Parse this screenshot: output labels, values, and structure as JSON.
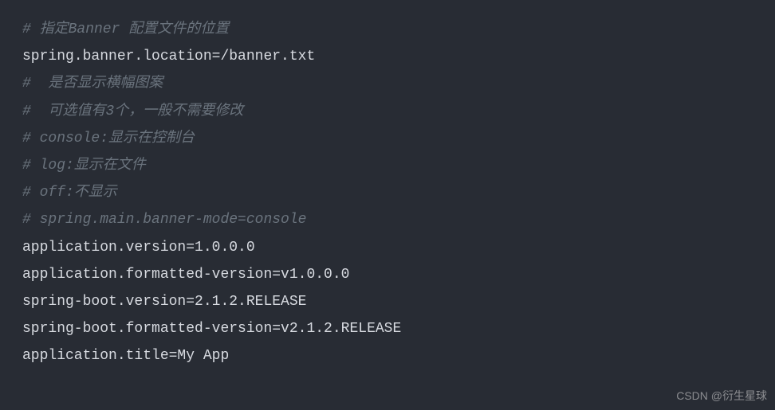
{
  "code": {
    "lines": [
      {
        "text": "# 指定Banner 配置文件的位置",
        "type": "comment"
      },
      {
        "text": "spring.banner.location=/banner.txt",
        "type": "property"
      },
      {
        "text": "#  是否显示横幅图案",
        "type": "comment"
      },
      {
        "text": "#  可选值有3个，一般不需要修改",
        "type": "comment"
      },
      {
        "text": "# console:显示在控制台",
        "type": "comment"
      },
      {
        "text": "# log:显示在文件",
        "type": "comment"
      },
      {
        "text": "# off:不显示",
        "type": "comment"
      },
      {
        "text": "# spring.main.banner-mode=console",
        "type": "comment"
      },
      {
        "text": "application.version=1.0.0.0",
        "type": "property"
      },
      {
        "text": "application.formatted-version=v1.0.0.0",
        "type": "property"
      },
      {
        "text": "spring-boot.version=2.1.2.RELEASE",
        "type": "property"
      },
      {
        "text": "spring-boot.formatted-version=v2.1.2.RELEASE",
        "type": "property"
      },
      {
        "text": "application.title=My App",
        "type": "property"
      }
    ]
  },
  "watermark": "CSDN @衍生星球"
}
